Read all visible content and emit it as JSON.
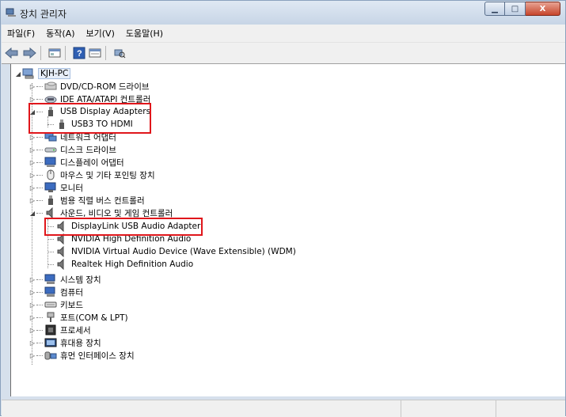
{
  "window": {
    "title": "장치 관리자",
    "min_label": "▁",
    "max_label": "□",
    "close_label": "X"
  },
  "menu": [
    "파일(F)",
    "동작(A)",
    "보기(V)",
    "도움말(H)"
  ],
  "tree": {
    "root": "KJH-PC",
    "items": [
      {
        "label": "DVD/CD-ROM 드라이브",
        "icon": "disc-drive-icon",
        "expanded": false
      },
      {
        "label": "IDE ATA/ATAPI 컨트롤러",
        "icon": "ide-controller-icon",
        "expanded": false
      },
      {
        "label": "USB Display Adapters",
        "icon": "usb-icon",
        "expanded": true,
        "children": [
          "USB3 TO HDMI"
        ]
      },
      {
        "label": "네트워크 어댑터",
        "icon": "network-adapter-icon",
        "expanded": false
      },
      {
        "label": "디스크 드라이브",
        "icon": "disk-drive-icon",
        "expanded": false
      },
      {
        "label": "디스플레이 어댑터",
        "icon": "display-adapter-icon",
        "expanded": false
      },
      {
        "label": "마우스 및 기타 포인팅 장치",
        "icon": "mouse-icon",
        "expanded": false
      },
      {
        "label": "모니터",
        "icon": "monitor-icon",
        "expanded": false
      },
      {
        "label": "범용 직렬 버스 컨트롤러",
        "icon": "usb-icon",
        "expanded": false
      },
      {
        "label": "사운드, 비디오 및 게임 컨트롤러",
        "icon": "speaker-icon",
        "expanded": true,
        "children": [
          "DisplayLink USB Audio Adapter",
          "NVIDIA High Definition Audio",
          "NVIDIA Virtual Audio Device (Wave Extensible) (WDM)",
          "Realtek High Definition Audio"
        ]
      },
      {
        "label": "시스템 장치",
        "icon": "computer-icon",
        "expanded": false
      },
      {
        "label": "컴퓨터",
        "icon": "computer-icon",
        "expanded": false
      },
      {
        "label": "키보드",
        "icon": "keyboard-icon",
        "expanded": false
      },
      {
        "label": "포트(COM & LPT)",
        "icon": "port-icon",
        "expanded": false
      },
      {
        "label": "프로세서",
        "icon": "processor-icon",
        "expanded": false
      },
      {
        "label": "휴대용 장치",
        "icon": "portable-device-icon",
        "expanded": false
      },
      {
        "label": "휴먼 인터페이스 장치",
        "icon": "hid-icon",
        "expanded": false
      }
    ]
  },
  "colors": {
    "highlight": "#e0161b"
  }
}
